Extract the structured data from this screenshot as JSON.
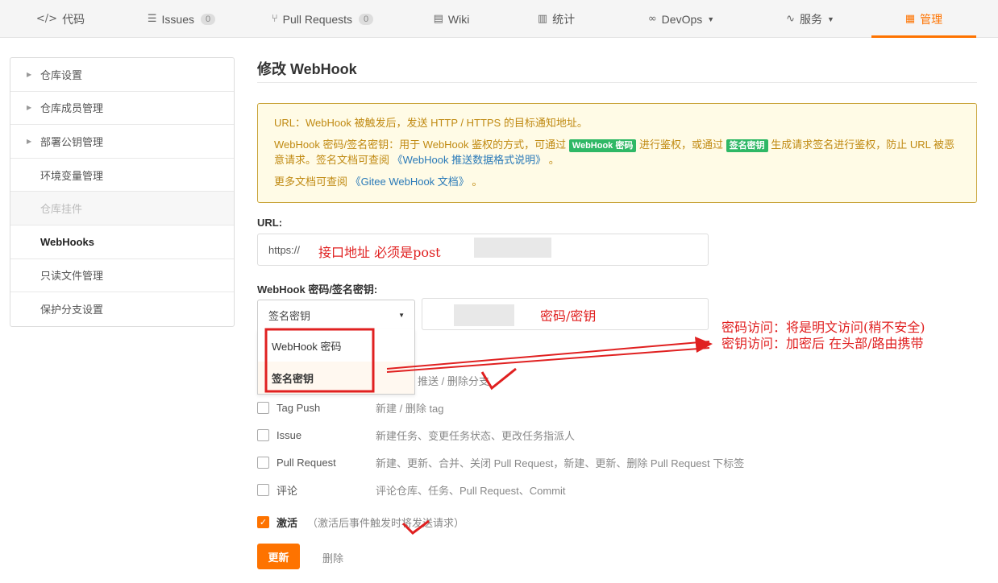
{
  "nav": {
    "tabs": [
      {
        "label": "代码",
        "icon": "code-icon"
      },
      {
        "label": "Issues",
        "count": "0",
        "icon": "issues-icon"
      },
      {
        "label": "Pull Requests",
        "count": "0",
        "icon": "pull-request-icon"
      },
      {
        "label": "Wiki",
        "icon": "wiki-icon"
      },
      {
        "label": "统计",
        "icon": "stats-icon"
      },
      {
        "label": "DevOps",
        "icon": "devops-icon"
      },
      {
        "label": "服务",
        "icon": "service-icon"
      },
      {
        "label": "管理",
        "icon": "manage-icon"
      }
    ],
    "active_color": "#fe7300"
  },
  "sidebar": {
    "items": [
      {
        "label": "仓库设置"
      },
      {
        "label": "仓库成员管理"
      },
      {
        "label": "部署公钥管理"
      },
      {
        "label": "环境变量管理"
      },
      {
        "label": "仓库挂件"
      },
      {
        "label": "WebHooks"
      },
      {
        "label": "只读文件管理"
      },
      {
        "label": "保护分支设置"
      }
    ]
  },
  "page": {
    "title": "修改 WebHook"
  },
  "notice": {
    "line1": "URL：WebHook 被触发后，发送 HTTP / HTTPS 的目标通知地址。",
    "line2_a": "WebHook 密码/签名密钥：用于 WebHook 鉴权的方式，可通过",
    "tag_password": "WebHook 密码",
    "line2_b": "进行鉴权，或通过",
    "tag_sign": "签名密钥",
    "line2_c": "生成请求签名进行鉴权，防止 URL 被恶意请求。签名文档可查阅",
    "line2_link": "《WebHook 推送数据格式说明》",
    "line2_end": "。",
    "line3_a": "更多文档可查阅",
    "line3_link": "《Gitee WebHook 文档》",
    "line3_end": "。"
  },
  "form": {
    "url_label": "URL:",
    "url_value": "https://",
    "secret_label": "WebHook 密码/签名密钥:",
    "secret_type_selected": "签名密钥",
    "secret_options": [
      "WebHook 密码",
      "签名密钥"
    ]
  },
  "events": [
    {
      "name": "",
      "desc": "送代码、推送 / 删除分支",
      "checked": false
    },
    {
      "name": "Tag Push",
      "desc": "新建 / 删除 tag",
      "checked": false
    },
    {
      "name": "Issue",
      "desc": "新建任务、变更任务状态、更改任务指派人",
      "checked": false
    },
    {
      "name": "Pull Request",
      "desc": "新建、更新、合并、关闭 Pull Request，新建、更新、删除 Pull Request 下标签",
      "checked": false
    },
    {
      "name": "评论",
      "desc": "评论仓库、任务、Pull Request、Commit",
      "checked": false
    }
  ],
  "activate": {
    "label": "激活",
    "hint": "（激活后事件触发时将发送请求）",
    "checked": true
  },
  "actions": {
    "update": "更新",
    "delete": "删除"
  },
  "annotations": {
    "url_note": "接口地址 必须是post",
    "secret_note": "密码/密钥",
    "right_note_1": "密码访问：将是明文访问(稍不安全)",
    "right_note_2": "密钥访问：加密后 在头部/路由携带",
    "color": "#e02020"
  }
}
